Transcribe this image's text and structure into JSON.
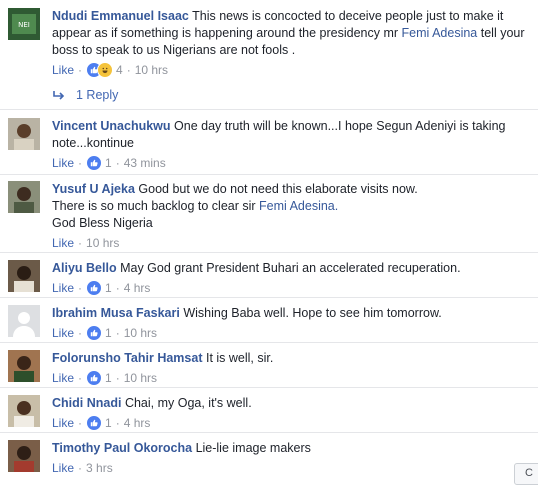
{
  "comments": [
    {
      "author": "Ndudi Emmanuel Isaac",
      "text_a": "This news is concocted to deceive people just to make it appear as if something is happening around the presidency mr ",
      "link": "Femi Adesina",
      "text_b": " tell your boss to speak to us Nigerians are not fools .",
      "like": "Like",
      "count": "4",
      "time": "10 hrs",
      "avatar_color": "#3b6b3e"
    },
    {
      "author": "Vincent Unachukwu",
      "text": "One day truth will be known...I hope Segun Adeniyi is taking note...kontinue",
      "like": "Like",
      "count": "1",
      "time": "43 mins",
      "avatar_color": "#6b5a3a"
    },
    {
      "author": "Yusuf U Ajeka",
      "line1": "Good but we do not need this elaborate visits now.",
      "line2a": "There is so much backlog to clear sir ",
      "link": "Femi Adesina.",
      "line3": "God Bless Nigeria",
      "like": "Like",
      "time": "10 hrs",
      "avatar_color": "#5a5f4a"
    },
    {
      "author": "Aliyu Bello",
      "text": "May God grant President Buhari an accelerated recuperation.",
      "like": "Like",
      "count": "1",
      "time": "4 hrs",
      "avatar_color": "#4a3a2e"
    },
    {
      "author": "Ibrahim Musa Faskari",
      "text": "Wishing Baba well. Hope to see him tomorrow.",
      "like": "Like",
      "count": "1",
      "time": "10 hrs",
      "avatar_color": "#d7d9dd"
    },
    {
      "author": "Folorunsho Tahir Hamsat",
      "text": "It is well, sir.",
      "like": "Like",
      "count": "1",
      "time": "10 hrs",
      "avatar_color": "#8a5a3b"
    },
    {
      "author": "Chidi Nnadi",
      "text": "Chai, my Oga, it's well.",
      "like": "Like",
      "count": "1",
      "time": "4 hrs",
      "avatar_color": "#7a6a4e"
    },
    {
      "author": "Timothy Paul Okorocha",
      "text": "Lie-lie image makers",
      "like": "Like",
      "time": "3 hrs",
      "avatar_color": "#5c4636"
    }
  ],
  "reply": {
    "label": "1 Reply"
  },
  "scroll_hint": "C"
}
